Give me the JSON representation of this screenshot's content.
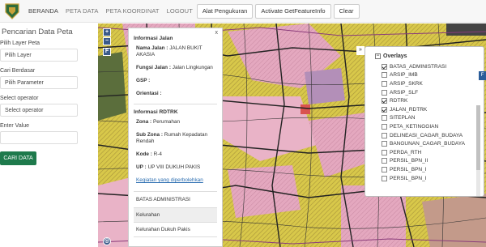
{
  "nav": {
    "items": [
      "BERANDA",
      "PETA DATA",
      "PETA KOORDINAT",
      "LOGOUT"
    ],
    "tool_button": "Alat Pengukuran",
    "activate_button": "Activate GetFeatureInfo",
    "clear_button": "Clear"
  },
  "sidebar": {
    "title": "Pencarian Data Peta",
    "layer_label": "Pilih Layer Peta",
    "layer_value": "Pilih Layer",
    "cari_label": "Cari Berdasar",
    "cari_value": "Pilih Parameter",
    "operator_label": "Select operator",
    "operator_value": "Select operator",
    "enter_label": "Enter Value",
    "enter_value": "",
    "submit": "CARI DATA"
  },
  "popup": {
    "close": "x",
    "jalan_title": "Informasi Jalan",
    "nama_jalan_key": "Nama Jalan :",
    "nama_jalan_val": "JALAN BUKIT AKASIA",
    "fungsi_key": "Fungsi Jalan :",
    "fungsi_val": "Jalan Lingkungan",
    "gsp_key": "GSP :",
    "orientasi_key": "Orientasi :",
    "rdtrk_title": "Informasi RDTRK",
    "zona_key": "Zona :",
    "zona_val": "Perumahan",
    "subzona_key": "Sub Zona :",
    "subzona_val": "Rumah Kepadatan Rendah",
    "kode_key": "Kode :",
    "kode_val": "R-4",
    "up_key": "UP :",
    "up_val": "UP VIII DUKUH PAKIS",
    "link": "Kegiatan yang diperbolehkan",
    "admin_head": "BATAS ADMINISTRASI",
    "admin_items": [
      "Kelurahan",
      "Kelurahan Dukuh Pakis"
    ]
  },
  "layers": {
    "title": "Overlays",
    "items": [
      {
        "label": "BATAS_ADMINISTRASI",
        "checked": true
      },
      {
        "label": "ARSIP_IMB",
        "checked": false
      },
      {
        "label": "ARSIP_SKRK",
        "checked": false
      },
      {
        "label": "ARSIP_SLF",
        "checked": false
      },
      {
        "label": "RDTRK",
        "checked": true
      },
      {
        "label": "JALAN_RDTRK",
        "checked": true
      },
      {
        "label": "SITEPLAN",
        "checked": false
      },
      {
        "label": "PETA_KETINGGIAN",
        "checked": false
      },
      {
        "label": "DELINEASI_CAGAR_BUDAYA",
        "checked": false
      },
      {
        "label": "BANGUNAN_CAGAR_BUDAYA",
        "checked": false
      },
      {
        "label": "PERDA_RTH",
        "checked": false
      },
      {
        "label": "PERSIL_BPN_II",
        "checked": false
      },
      {
        "label": "PERSIL_BPN_I",
        "checked": false
      },
      {
        "label": "PERSIL_BPN_I",
        "checked": false
      }
    ]
  },
  "map_controls": {
    "zoom_in": "+",
    "zoom_out": "−",
    "layer_f": "F",
    "expand": "»"
  },
  "colors": {
    "primary_green": "#1e7a4c",
    "map_pink": "#e9b3c7",
    "map_yellow": "#e6d84a",
    "link": "#2a6db0"
  }
}
